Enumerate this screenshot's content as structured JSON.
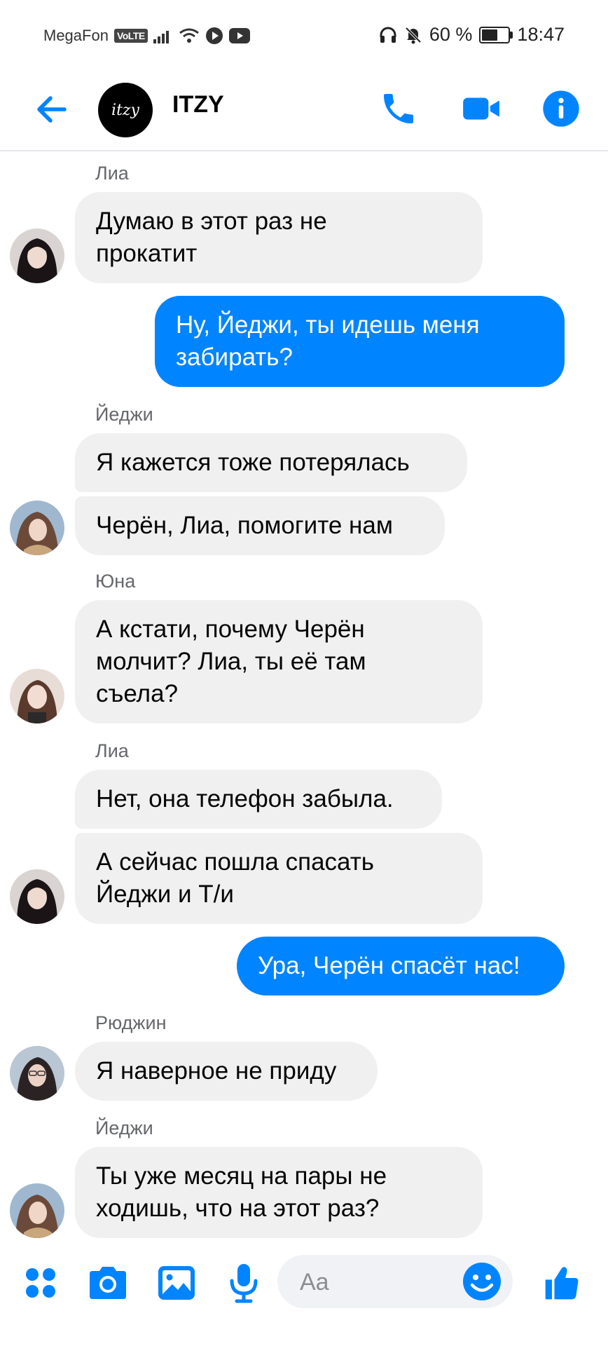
{
  "status_bar": {
    "carrier": "MegaFon",
    "network_badge": "VoLTE",
    "battery_percent": "60 %",
    "battery_level": 0.6,
    "time": "18:47"
  },
  "header": {
    "group_avatar_text": "itzy",
    "title": "ITZY"
  },
  "messages": [
    {
      "sender": "Лиа",
      "lines": [
        "Думаю в этот раз не",
        "прокатит"
      ]
    },
    {
      "outgoing": true,
      "lines": [
        "Ну, Йеджи, ты идешь меня",
        "забирать?"
      ]
    },
    {
      "sender": "Йеджи",
      "lines": [
        "Я кажется тоже потерялась"
      ]
    },
    {
      "lines": [
        "Черён, Лиа, помогите нам"
      ]
    },
    {
      "sender": "Юна",
      "lines": [
        "А кстати, почему Черён",
        "молчит? Лиа, ты её там",
        "съела?"
      ]
    },
    {
      "sender": "Лиа",
      "lines": [
        "Нет, она телефон забыла."
      ]
    },
    {
      "lines": [
        "А сейчас пошла спасать",
        "Йеджи и Т/и"
      ]
    },
    {
      "outgoing": true,
      "lines": [
        "Ура, Черён спасёт нас!"
      ]
    },
    {
      "sender": "Рюджин",
      "lines": [
        "Я наверное не приду"
      ]
    },
    {
      "sender": "Йеджи",
      "lines": [
        "Ты уже месяц на пары не",
        "ходишь, что на этот раз?"
      ]
    }
  ],
  "composer": {
    "placeholder": "Aa"
  },
  "colors": {
    "accent": "#0084ff",
    "incoming_bubble": "#f0f0f0",
    "sender_name": "#65676b"
  },
  "icons": [
    "back-arrow-icon",
    "phone-icon",
    "video-camera-icon",
    "info-icon",
    "apps-grid-icon",
    "camera-icon",
    "gallery-icon",
    "microphone-icon",
    "emoji-icon",
    "thumbs-up-icon"
  ]
}
